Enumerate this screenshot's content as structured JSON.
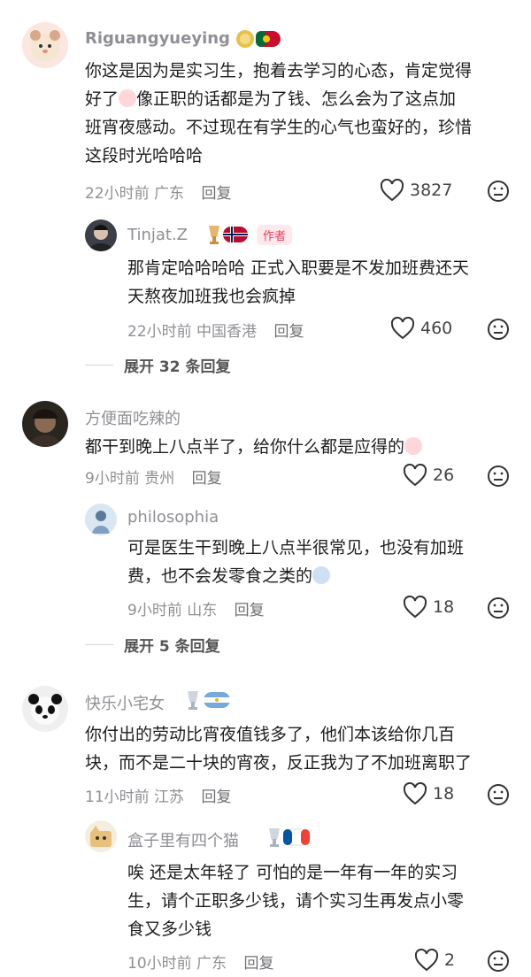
{
  "comments": [
    {
      "username": "Riguangyueying",
      "text_lines": [
        "你这是因为是实习生，抱着去学习的心态，肯定觉得",
        "好了",
        "像正职的话都是为了钱、怎么会为了这点加",
        "班宵夜感动。不过现在有学生的心气也蛮好的，珍惜",
        "这段时光哈哈哈"
      ],
      "time": "22小时前",
      "location": "广东",
      "reply_label": "回复",
      "likes": "3827"
    },
    {
      "username": "Tinjat.Z",
      "author_tag": "作者",
      "text_lines": [
        "那肯定哈哈哈哈 正式入职要是不发加班费还天",
        "天熬夜加班我也会疯掉"
      ],
      "time": "22小时前",
      "location": "中国香港",
      "reply_label": "回复",
      "likes": "460"
    },
    {
      "username": "方便面吃辣的",
      "text_lines": [
        "都干到晚上八点半了，给你什么都是应得的"
      ],
      "time": "9小时前",
      "location": "贵州",
      "reply_label": "回复",
      "likes": "26"
    },
    {
      "username": "philosophia",
      "text_lines": [
        "可是医生干到晚上八点半很常见，也没有加班",
        "费，也不会发零食之类的"
      ],
      "time": "9小时前",
      "location": "山东",
      "reply_label": "回复",
      "likes": "18"
    },
    {
      "username": "快乐小宅女",
      "text_lines": [
        "你付出的劳动比宵夜值钱多了，他们本该给你几百",
        "块，而不是二十块的宵夜，反正我为了不加班离职了"
      ],
      "time": "11小时前",
      "location": "江苏",
      "reply_label": "回复",
      "likes": "18"
    },
    {
      "username": "盒子里有四个猫",
      "text_lines": [
        "唉 还是太年轻了 可怕的是一年有一年的实习",
        "生，请个正职多少钱，请个实习生再发点小零",
        "食又多少钱"
      ],
      "time": "10小时前",
      "location": "广东",
      "reply_label": "回复",
      "likes": "2"
    }
  ],
  "expand": [
    {
      "label": "展开 32 条回复"
    },
    {
      "label": "展开 5 条回复"
    }
  ],
  "icons": {
    "like": "heart-outline-icon",
    "dislike": "meh-face-icon"
  },
  "colors": {
    "author_tag_bg": "#fde9ec",
    "author_tag_text": "#f23a5a"
  }
}
